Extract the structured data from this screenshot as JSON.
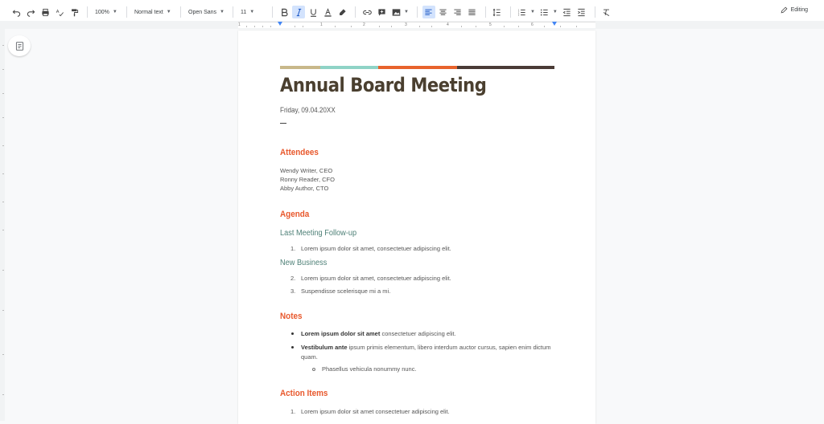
{
  "toolbar": {
    "zoom": "100%",
    "style": "Normal text",
    "font": "Open Sans",
    "size": "11",
    "mode": "Editing"
  },
  "ruler": {
    "numbers": [
      "1",
      "1",
      "2",
      "3",
      "4",
      "5",
      "6"
    ]
  },
  "document": {
    "bar_colors": [
      "#c8b88a",
      "#8fd3c6",
      "#e8632c",
      "#4a3b36"
    ],
    "title": "Annual Board Meeting",
    "date": "Friday, 09.04.20XX",
    "attendees_heading": "Attendees",
    "attendees": [
      "Wendy Writer, CEO",
      "Ronny Reader, CFO",
      "Abby Author, CTO"
    ],
    "agenda_heading": "Agenda",
    "followup_heading": "Last Meeting Follow-up",
    "followup_items": [
      {
        "num": "1.",
        "text": "Lorem ipsum dolor sit amet, consectetuer adipiscing elit."
      }
    ],
    "newbiz_heading": "New Business",
    "newbiz_items": [
      {
        "num": "2.",
        "text": "Lorem ipsum dolor sit amet, consectetuer adipiscing elit."
      },
      {
        "num": "3.",
        "text": "Suspendisse scelerisque mi a mi."
      }
    ],
    "notes_heading": "Notes",
    "notes": [
      {
        "bold": "Lorem ipsum dolor sit amet",
        "text": " consectetuer adipiscing elit."
      },
      {
        "bold": "Vestibulum ante",
        "text": " ipsum primis elementum, libero interdum auctor cursus, sapien enim dictum quam."
      }
    ],
    "sub_note": "Phasellus vehicula nonummy nunc.",
    "actions_heading": "Action Items",
    "actions": [
      {
        "num": "1.",
        "text": "Lorem ipsum dolor sit amet consectetuer adipiscing elit."
      }
    ]
  }
}
